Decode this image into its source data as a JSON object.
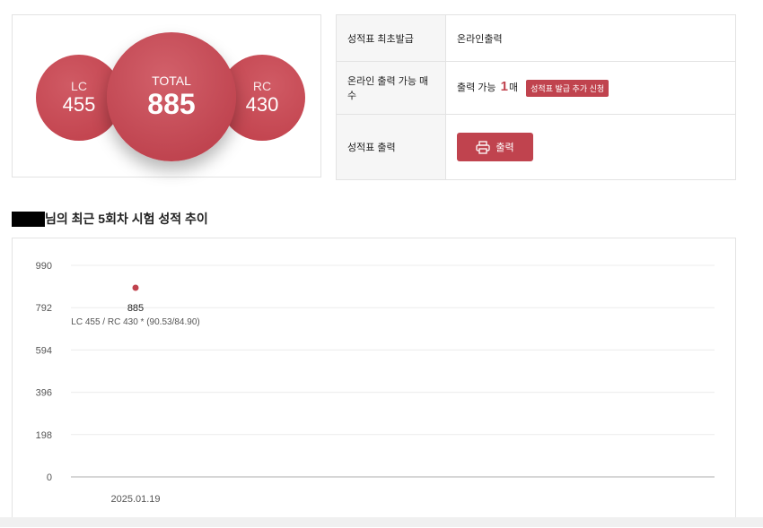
{
  "scores": {
    "lc_label": "LC",
    "lc_value": "455",
    "total_label": "TOTAL",
    "total_value": "885",
    "rc_label": "RC",
    "rc_value": "430"
  },
  "info": {
    "row1_label": "성적표 최초발급",
    "row1_value": "온라인출력",
    "row2_label": "온라인 출력 가능 매수",
    "row2_prefix": "출력 가능",
    "row2_count": "1",
    "row2_unit": "매",
    "row2_badge": "성적표 발급 추가 신청",
    "row3_label": "성적표 출력",
    "print_label": "출력"
  },
  "trend": {
    "title_suffix": "님의 최근 5회차 시험 성적 추이"
  },
  "chart_data": {
    "type": "line",
    "y_ticks": [
      0,
      198,
      396,
      594,
      792,
      990
    ],
    "ylim": [
      0,
      990
    ],
    "x": [
      "2025.01.19"
    ],
    "series": [
      {
        "values": [
          885
        ]
      }
    ],
    "point_labels": [
      "885"
    ],
    "point_sublabels": [
      "LC 455 / RC 430 * (90.53/84.90)"
    ],
    "grid": true,
    "accent_color": "#c0434e"
  }
}
